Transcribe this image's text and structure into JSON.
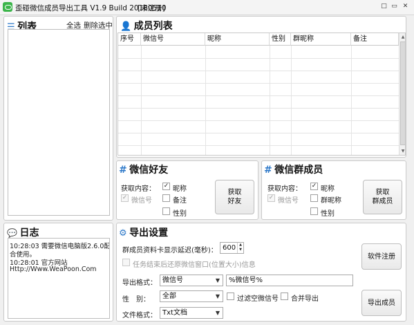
{
  "window": {
    "title": "歪碰微信成员导出工具 V1.9 Build 20180510",
    "status": "[未注册]",
    "controls": [
      "□",
      "▭",
      "✕"
    ]
  },
  "list_panel": {
    "title": "列表",
    "select_all": "全选",
    "delete_selected": "删除选中"
  },
  "members_panel": {
    "title": "成员列表",
    "columns": [
      "序号",
      "微信号",
      "昵称",
      "性别",
      "群昵称",
      "备注"
    ]
  },
  "friends_panel": {
    "title": "微信好友",
    "content_label": "获取内容：",
    "wxid": {
      "label": "微信号",
      "checked": true
    },
    "nickname": {
      "label": "昵称",
      "checked": true
    },
    "remark": {
      "label": "备注",
      "checked": false
    },
    "gender": {
      "label": "性别",
      "checked": false
    },
    "button": [
      "获取",
      "好友"
    ]
  },
  "group_panel": {
    "title": "微信群成员",
    "content_label": "获取内容：",
    "wxid": {
      "label": "微信号",
      "checked": true
    },
    "nickname": {
      "label": "昵称",
      "checked": true
    },
    "group_nickname": {
      "label": "群昵称",
      "checked": false
    },
    "gender": {
      "label": "性别",
      "checked": false
    },
    "button": [
      "获取",
      "群成员"
    ]
  },
  "log_panel": {
    "title": "日志",
    "lines": [
      "10:28:03    需要微信电脑版2.6.0配",
      "合使用。",
      "10:28:01    官方网站",
      "Http://Www.WeaPoon.Com"
    ]
  },
  "export_panel": {
    "title": "导出设置",
    "delay_label": "群成员资料卡显示延迟(毫秒)：",
    "delay_value": "600",
    "restore_label": "任务结束后还原微信窗口(位置大小)信息",
    "format_label": "导出格式：",
    "format_select": "微信号",
    "format_template": "%微信号%",
    "gender_label": "性　别：",
    "gender_select": "全部",
    "filter_empty_label": "过滤空微信号",
    "merge_label": "合并导出",
    "file_format_label": "文件格式：",
    "file_format_select": "Txt文档",
    "register_button": "软件注册",
    "export_button": "导出成员"
  }
}
